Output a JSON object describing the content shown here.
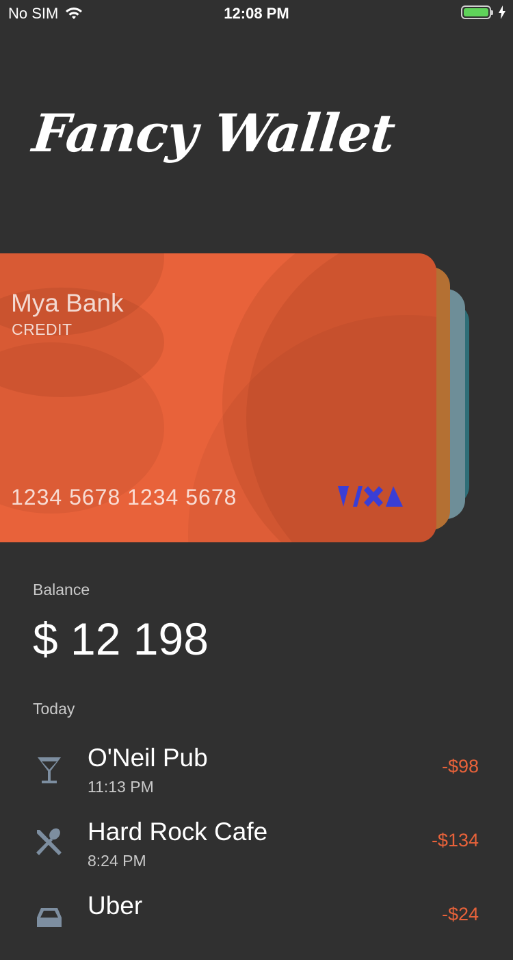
{
  "status_bar": {
    "carrier": "No SIM",
    "time": "12:08 PM"
  },
  "app": {
    "title": "Fancy Wallet"
  },
  "card": {
    "bank": "Mya Bank",
    "type": "CREDIT",
    "number": "1234 5678 1234 5678",
    "network": "VIXA",
    "color": "#e8623a"
  },
  "balance": {
    "label": "Balance",
    "value": "$ 12 198"
  },
  "transactions": {
    "section_label": "Today",
    "items": [
      {
        "name": "O'Neil Pub",
        "time": "11:13 PM",
        "amount": "-$98",
        "icon": "cocktail-icon"
      },
      {
        "name": "Hard Rock Cafe",
        "time": "8:24 PM",
        "amount": "-$134",
        "icon": "utensils-icon"
      },
      {
        "name": "Uber",
        "time": "",
        "amount": "-$24",
        "icon": "car-icon"
      }
    ]
  },
  "colors": {
    "background": "#303030",
    "accent": "#e8623a",
    "secondary_text": "#c9c9c9"
  }
}
